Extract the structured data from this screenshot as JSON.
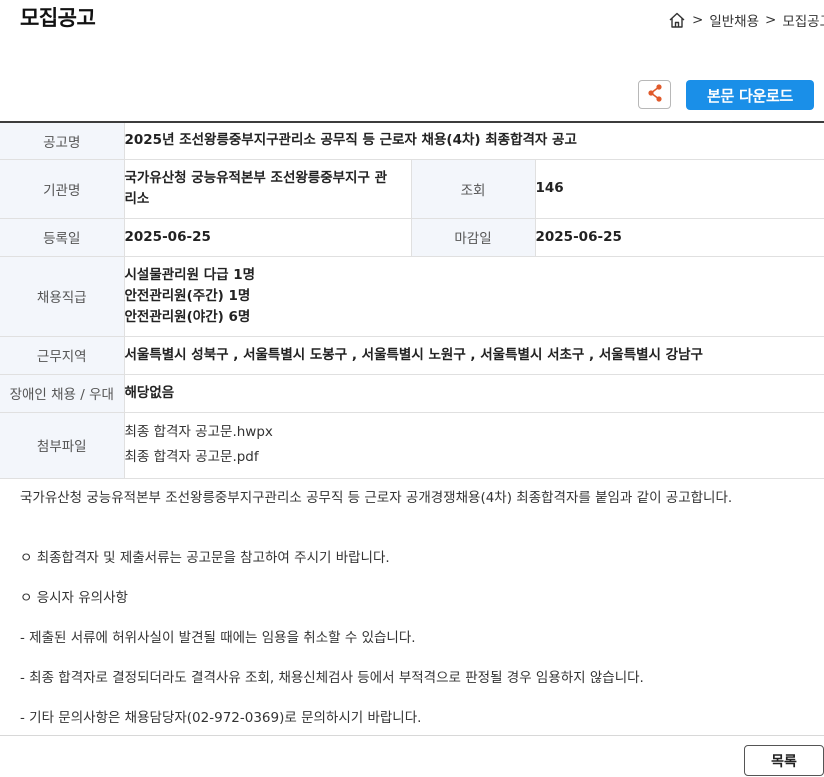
{
  "page": {
    "title": "모집공고"
  },
  "breadcrumb": {
    "sep": ">",
    "items": [
      "일반채용",
      "모집공고"
    ]
  },
  "actions": {
    "download_label": "본문 다운로드"
  },
  "info": {
    "title_label": "공고명",
    "title": "2025년 조선왕릉중부지구관리소 공무직 등 근로자 채용(4차) 최종합격자 공고",
    "org_label": "기관명",
    "org": "국가유산청 궁능유적본부 조선왕릉중부지구 관리소",
    "views_label": "조회",
    "views": "146",
    "reg_label": "등록일",
    "reg_date": "2025-06-25",
    "deadline_label": "마감일",
    "deadline": "2025-06-25",
    "positions_label": "채용직급",
    "positions": [
      "시설물관리원 다급 1명",
      "안전관리원(주간) 1명",
      "안전관리원(야간) 6명"
    ],
    "region_label": "근무지역",
    "region": "서울특별시 성북구 , 서울특별시 도봉구 , 서울특별시 노원구 , 서울특별시 서초구 , 서울특별시 강남구",
    "disabled_label": "장애인 채용 / 우대",
    "disabled": "해당없음",
    "attach_label": "첨부파일",
    "attachments": [
      "최종 합격자 공고문.hwpx",
      "최종 합격자 공고문.pdf"
    ]
  },
  "body": {
    "lines": [
      "국가유산청 궁능유적본부 조선왕릉중부지구관리소 공무직 등 근로자 공개경쟁채용(4차) 최종합격자를 붙임과 같이 공고합니다.",
      "ㅇ 최종합격자 및 제출서류는 공고문을 참고하여 주시기 바랍니다.",
      "ㅇ 응시자 유의사항",
      "- 제출된 서류에 허위사실이 발견될 때에는 임용을 취소할 수 있습니다.",
      "- 최종 합격자로 결정되더라도 결격사유 조회, 채용신체검사 등에서 부적격으로 판정될 경우 임용하지 않습니다.",
      "- 기타 문의사항은 채용담당자(02-972-0369)로 문의하시기 바랍니다."
    ]
  },
  "footer": {
    "list_label": "목록"
  }
}
